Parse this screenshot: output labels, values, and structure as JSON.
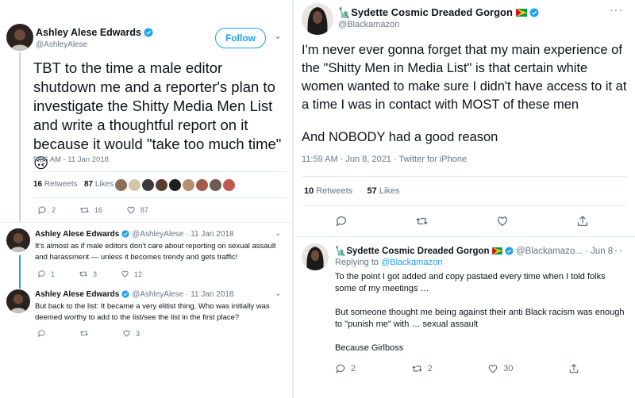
{
  "left": {
    "tweet": {
      "name": "Ashley Alese Edwards",
      "handle": "@AshleyAlese",
      "follow_label": "Follow",
      "text": "TBT to the time a male editor shutdown me and a reporter's plan to investigate the Shitty Media Men List and write a thoughtful report on it because it would \"take too much time\" 🙃",
      "timestamp": "5:26 AM - 11 Jan 2018",
      "retweets_count": "16",
      "retweets_label": "Retweets",
      "likes_count": "87",
      "likes_label": "Likes",
      "actions": {
        "replies": "2",
        "retweets": "16",
        "likes": "87"
      }
    },
    "replies": [
      {
        "name": "Ashley Alese Edwards",
        "handle_date": "@AshleyAlese · 11 Jan 2018",
        "text": "It's almost as if male editors don't care about reporting on sexual assault and harassment — unless it becomes trendy and gets traffic!",
        "actions": {
          "replies": "1",
          "retweets": "3",
          "likes": "12"
        }
      },
      {
        "name": "Ashley Alese Edwards",
        "handle_date": "@AshleyAlese · 11 Jan 2018",
        "text": "But back to the list: It became a very elitist thing. Who was initially was deemed worthy to add to the list/see the list in the first place?",
        "actions": {
          "replies": "",
          "retweets": "",
          "likes": "3"
        }
      }
    ]
  },
  "right": {
    "tweet": {
      "name": "Sydette Cosmic Dreaded Gorgon",
      "handle": "@Blackamazon",
      "text": "I'm never ever gonna forget that my main experience of the \"Shitty Men in Media List\" is that certain white women wanted to make sure I didn't have access to it at a time I was in contact with MOST of these men",
      "text2": "And NOBODY had a good reason",
      "timestamp": "11:59 AM · Jun 8, 2021 · Twitter for iPhone",
      "retweets_count": "10",
      "retweets_label": "Retweets",
      "likes_count": "57",
      "likes_label": "Likes"
    },
    "reply": {
      "name": "Sydette Cosmic Dreaded Gorgon",
      "handle_date": "@Blackamazo... · Jun 8",
      "replying_to_label": "Replying to",
      "replying_to_handle": "@Blackamazon",
      "p1": "To the point I got added and copy pastaed every time when I told folks some of my meetings …",
      "p2": "But someone thought me being against their anti Black racism was enough to \"punish me\" with … sexual assault",
      "p3": "Because Girlboss",
      "actions": {
        "replies": "2",
        "retweets": "2",
        "likes": "30"
      }
    }
  },
  "colors": {
    "accent": "#1da1f2",
    "muted": "#657786",
    "text": "#0f1419",
    "divider": "#e6ecf0"
  }
}
